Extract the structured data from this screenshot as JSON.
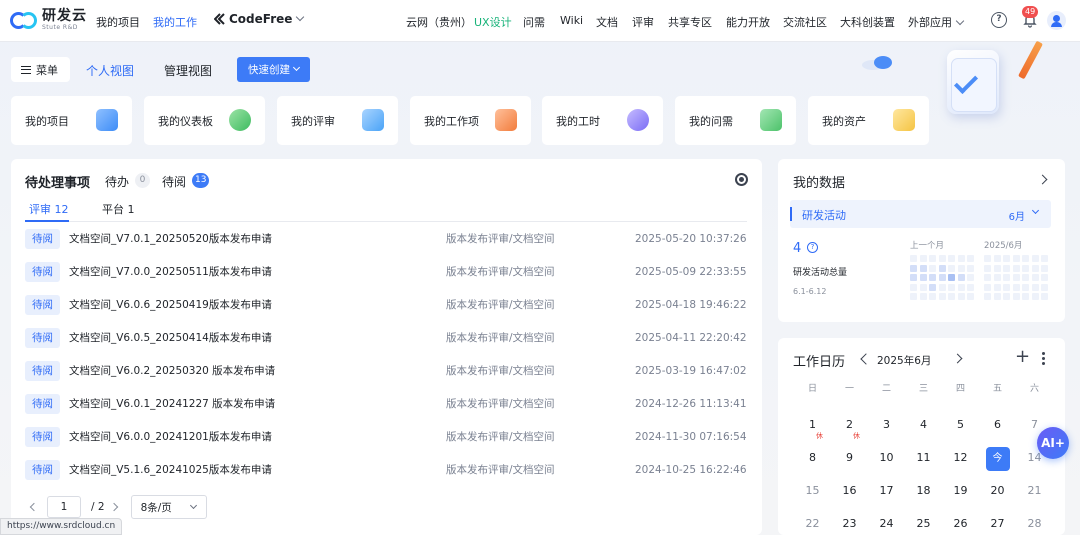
{
  "brand": {
    "name": "研发云",
    "tagline": "Stute R&D"
  },
  "topnav": {
    "left_links": [
      {
        "label": "我的项目"
      },
      {
        "label": "我的工作"
      }
    ],
    "codefree": "CodeFree",
    "right_links": [
      {
        "label": "云网（贵州）"
      },
      {
        "label": "UX设计"
      },
      {
        "label": "问需"
      },
      {
        "label": "Wiki"
      },
      {
        "label": "文档"
      },
      {
        "label": "评审"
      },
      {
        "label": "共享专区"
      },
      {
        "label": "能力开放"
      },
      {
        "label": "交流社区"
      },
      {
        "label": "大科创装置"
      },
      {
        "label": "外部应用"
      }
    ],
    "notification_count": "49",
    "help_glyph": "?"
  },
  "toolbar": {
    "menu_label": "菜单",
    "tab_personal": "个人视图",
    "tab_manage": "管理视图",
    "quick_create": "快速创建"
  },
  "quick_cards": [
    {
      "label": "我的项目",
      "icon": "project-icon",
      "color": "#3d8cf7"
    },
    {
      "label": "我的仪表板",
      "icon": "dashboard-icon",
      "color": "#3dbb5f"
    },
    {
      "label": "我的评审",
      "icon": "review-icon",
      "color": "#4aa3f7"
    },
    {
      "label": "我的工作项",
      "icon": "workitem-icon",
      "color": "#f27c3c"
    },
    {
      "label": "我的工时",
      "icon": "clock-icon",
      "color": "#7a6cf5"
    },
    {
      "label": "我的问需",
      "icon": "chat-icon",
      "color": "#4cc26a"
    },
    {
      "label": "我的资产",
      "icon": "asset-icon",
      "color": "#f5c443"
    }
  ],
  "pending": {
    "title": "待处理事项",
    "tab_todo": "待办",
    "todo_count": "0",
    "tab_read": "待阅",
    "read_count": "13",
    "subtab_review": "评审 12",
    "subtab_platform": "平台 1",
    "rows": [
      {
        "tag": "待阅",
        "title": "文档空间_V7.0.1_20250520版本发布申请",
        "category": "版本发布评审/文档空间",
        "time": "2025-05-20 10:37:26"
      },
      {
        "tag": "待阅",
        "title": "文档空间_V7.0.0_20250511版本发布申请",
        "category": "版本发布评审/文档空间",
        "time": "2025-05-09 22:33:55"
      },
      {
        "tag": "待阅",
        "title": "文档空间_V6.0.6_20250419版本发布申请",
        "category": "版本发布评审/文档空间",
        "time": "2025-04-18 19:46:22"
      },
      {
        "tag": "待阅",
        "title": "文档空间_V6.0.5_20250414版本发布申请",
        "category": "版本发布评审/文档空间",
        "time": "2025-04-11 22:20:42"
      },
      {
        "tag": "待阅",
        "title": "文档空间_V6.0.2_20250320 版本发布申请",
        "category": "版本发布评审/文档空间",
        "time": "2025-03-19 16:47:02"
      },
      {
        "tag": "待阅",
        "title": "文档空间_V6.0.1_20241227 版本发布申请",
        "category": "版本发布评审/文档空间",
        "time": "2024-12-26 11:13:41"
      },
      {
        "tag": "待阅",
        "title": "文档空间_V6.0.0_20241201版本发布申请",
        "category": "版本发布评审/文档空间",
        "time": "2024-11-30 07:16:54"
      },
      {
        "tag": "待阅",
        "title": "文档空间_V5.1.6_20241025版本发布申请",
        "category": "版本发布评审/文档空间",
        "time": "2024-10-25 16:22:46"
      }
    ],
    "pager": {
      "current": "1",
      "total": "/ 2",
      "page_size": "8条/页"
    }
  },
  "mydata": {
    "title": "我的数据",
    "activity_label": "研发活动",
    "month_select": "6月",
    "total": "4",
    "total_help": "?",
    "total_label": "研发活动总量",
    "range": "6.1-6.12",
    "last_month_label": "上一个月",
    "current_month_label": "2025/6月"
  },
  "calendar": {
    "title": "工作日历",
    "month": "2025年6月",
    "weekdays": [
      "日",
      "一",
      "二",
      "三",
      "四",
      "五",
      "六"
    ],
    "rest_mark": "休",
    "weeks": [
      [
        {
          "d": "1",
          "rest": true
        },
        {
          "d": "2",
          "rest": true
        },
        {
          "d": "3"
        },
        {
          "d": "4"
        },
        {
          "d": "5"
        },
        {
          "d": "6"
        },
        {
          "d": "7",
          "muted": true
        }
      ],
      [
        {
          "d": "8"
        },
        {
          "d": "9"
        },
        {
          "d": "10"
        },
        {
          "d": "11"
        },
        {
          "d": "12"
        },
        {
          "d": "今",
          "today": true
        },
        {
          "d": "14",
          "muted": true
        }
      ],
      [
        {
          "d": "15",
          "muted": true
        },
        {
          "d": "16"
        },
        {
          "d": "17"
        },
        {
          "d": "18"
        },
        {
          "d": "19"
        },
        {
          "d": "20"
        },
        {
          "d": "21",
          "muted": true
        }
      ],
      [
        {
          "d": "22",
          "muted": true
        },
        {
          "d": "23"
        },
        {
          "d": "24"
        },
        {
          "d": "25"
        },
        {
          "d": "26"
        },
        {
          "d": "27"
        },
        {
          "d": "28",
          "muted": true
        }
      ]
    ]
  },
  "ai_button": "AI+",
  "status_url": "https://www.srdcloud.cn",
  "colors": {
    "accent": "#2f6bf6",
    "tag_bg": "#e8effd",
    "badge_red": "#f04f4f"
  }
}
